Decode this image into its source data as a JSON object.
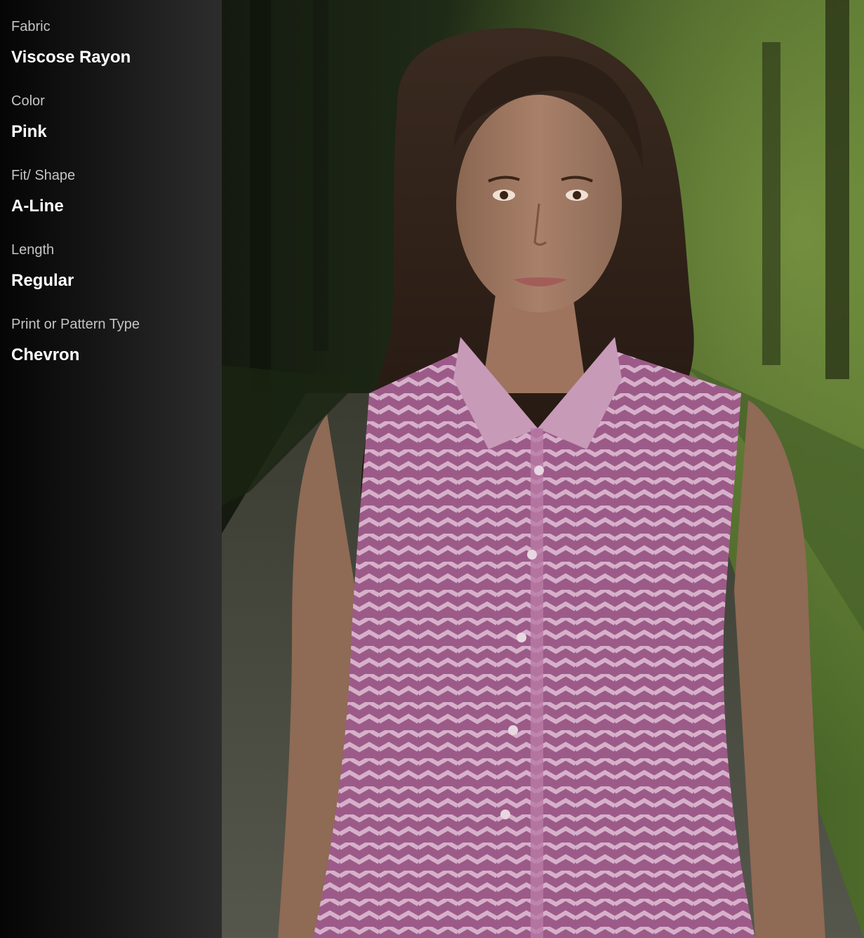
{
  "attributes": [
    {
      "label": "Fabric",
      "value": "Viscose Rayon"
    },
    {
      "label": "Color",
      "value": "Pink"
    },
    {
      "label": "Fit/ Shape",
      "value": "A-Line"
    },
    {
      "label": "Length",
      "value": "Regular"
    },
    {
      "label": "Print or Pattern Type",
      "value": "Chevron"
    }
  ],
  "colors": {
    "sidebar_start": "#050505",
    "sidebar_end": "#2d2d2d",
    "label": "#c4c4c4",
    "value": "#ffffff",
    "shirt": "#a85f92",
    "shirt_stripe": "#d7b2cc",
    "foliage": "#4f6f2c",
    "path": "#5e6052"
  }
}
